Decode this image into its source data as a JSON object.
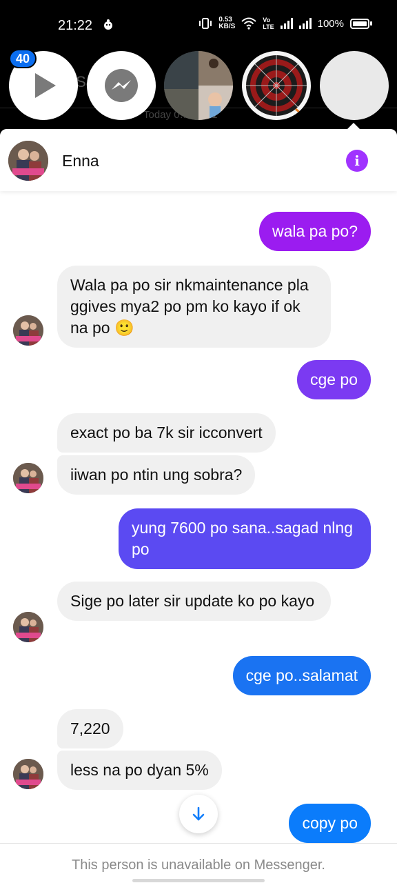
{
  "status_bar": {
    "time": "21:22",
    "net_speed_value": "0.53",
    "net_speed_unit": "KB/S",
    "lte_top": "Vo",
    "lte_bottom": "LTE",
    "battery": "100%"
  },
  "chat_heads": {
    "badge_count": "40",
    "items": [
      "play-head",
      "messenger-head",
      "photo-head",
      "dartboard-head",
      "blank-head"
    ]
  },
  "background": {
    "letter": "Sa",
    "timestamp": "Today 0… …M1"
  },
  "header": {
    "name": "Enna",
    "info_icon": "info-icon"
  },
  "colors": {
    "accent_purple": "#a033ff",
    "bubble_gradient": [
      "#9b1cf0",
      "#7b3af2",
      "#5b4af2",
      "#1a73f2",
      "#0b7cfb"
    ],
    "incoming_bubble": "#f0f0f0"
  },
  "messages": [
    {
      "dir": "out",
      "text": "wala pa po?"
    },
    {
      "dir": "in",
      "text": "Wala pa po sir nkmaintenance pla ggives mya2 po pm ko kayo if ok na po 🙂"
    },
    {
      "dir": "out",
      "text": "cge po"
    },
    {
      "dir": "in",
      "text": "exact po ba 7k sir icconvert"
    },
    {
      "dir": "in",
      "text": "iiwan po ntin ung sobra?"
    },
    {
      "dir": "out",
      "text": "yung 7600 po sana..sagad nlng po"
    },
    {
      "dir": "in",
      "text": "Sige po later sir update ko po kayo"
    },
    {
      "dir": "out",
      "text": "cge po..salamat"
    },
    {
      "dir": "in",
      "text": "7,220"
    },
    {
      "dir": "in",
      "text": "less na po dyan 5%"
    },
    {
      "dir": "out",
      "text": "copy po"
    }
  ],
  "footer": {
    "notice": "This person is unavailable on Messenger."
  }
}
